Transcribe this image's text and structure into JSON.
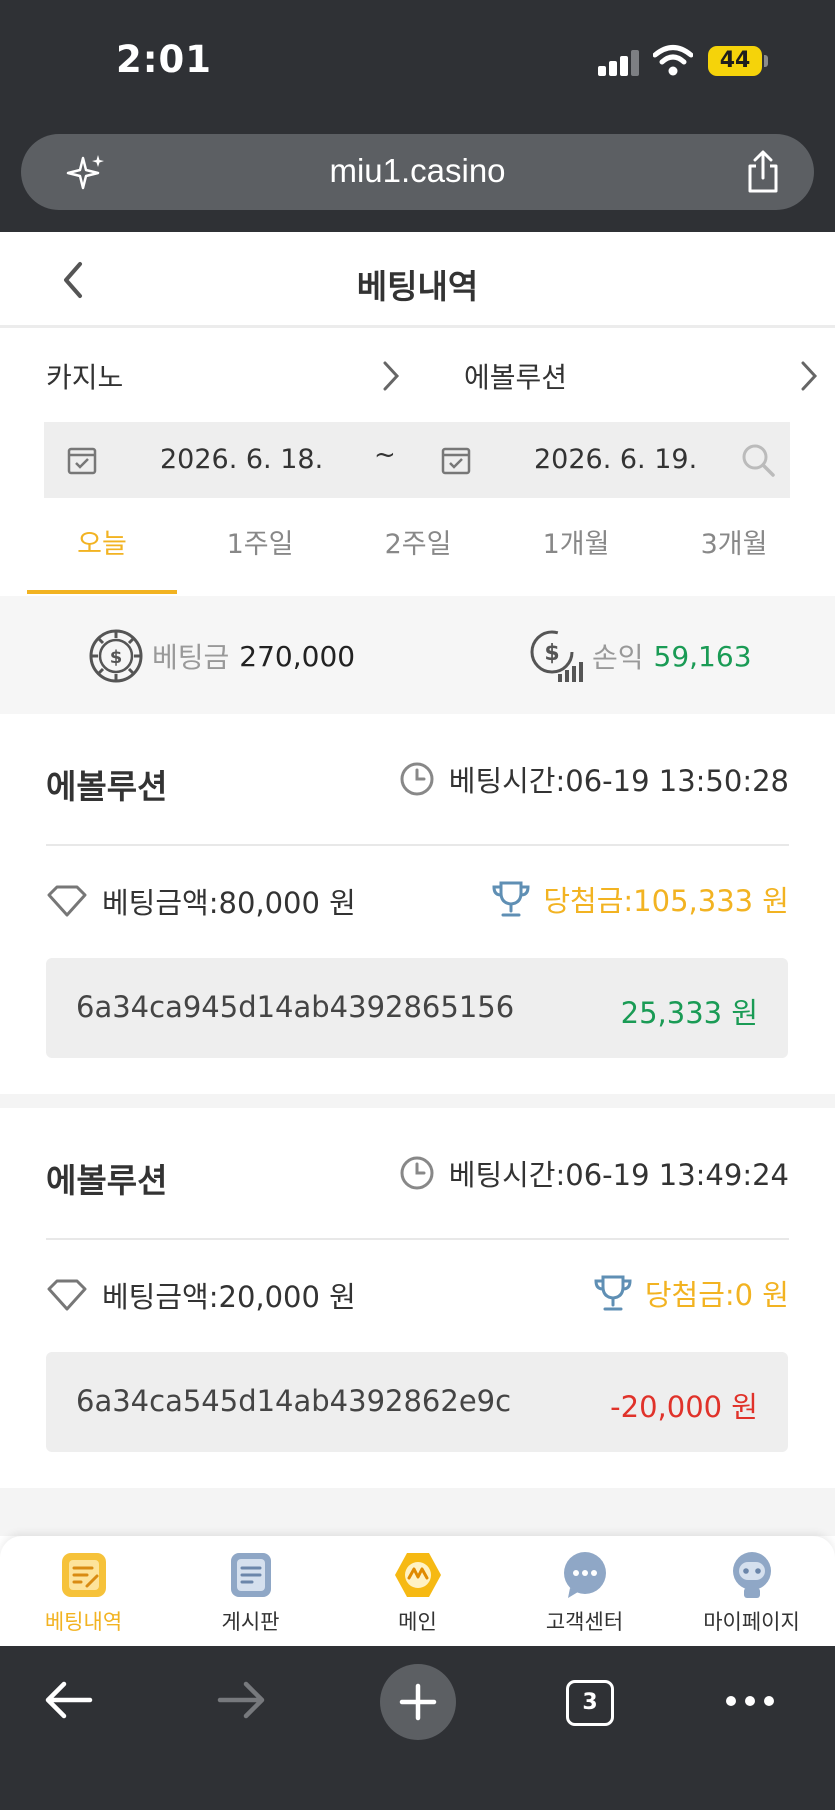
{
  "status_bar": {
    "time": "2:01",
    "battery": "44"
  },
  "browser": {
    "url": "miu1.casino",
    "tab_count": "3"
  },
  "header": {
    "title": "베팅내역"
  },
  "filters": {
    "category": "카지노",
    "provider": "에볼루션",
    "date_from": "2026. 6. 18.",
    "date_separator": "~",
    "date_to": "2026. 6. 19."
  },
  "period_tabs": [
    {
      "label": "오늘",
      "active": true
    },
    {
      "label": "1주일",
      "active": false
    },
    {
      "label": "2주일",
      "active": false
    },
    {
      "label": "1개월",
      "active": false
    },
    {
      "label": "3개월",
      "active": false
    }
  ],
  "summary": {
    "bet_label": "베팅금",
    "bet_value": "270,000",
    "profit_label": "손익",
    "profit_value": "59,163"
  },
  "bets": [
    {
      "game": "에볼루션",
      "time": "베팅시간:06-19 13:50:28",
      "bet_amount": "베팅금액:80,000 원",
      "win_amount": "당첨금:105,333 원",
      "tx_id": "6a34ca945d14ab4392865156",
      "profit": "25,333 원"
    },
    {
      "game": "에볼루션",
      "time": "베팅시간:06-19 13:49:24",
      "bet_amount": "베팅금액:20,000 원",
      "win_amount": "당첨금:0 원",
      "tx_id": "6a34ca545d14ab4392862e9c",
      "profit": "-20,000 원"
    }
  ],
  "bottom_nav": [
    {
      "label": "베팅내역",
      "icon": "bet-history-icon",
      "active": true
    },
    {
      "label": "게시판",
      "icon": "board-icon",
      "active": false
    },
    {
      "label": "메인",
      "icon": "main-icon",
      "active": false
    },
    {
      "label": "고객센터",
      "icon": "chat-icon",
      "active": false
    },
    {
      "label": "마이페이지",
      "icon": "profile-icon",
      "active": false
    }
  ],
  "colors": {
    "accent": "#f2b322",
    "profit_positive": "#1a9b55",
    "profit_negative": "#e0322a",
    "chrome_dark": "#2f3135"
  }
}
